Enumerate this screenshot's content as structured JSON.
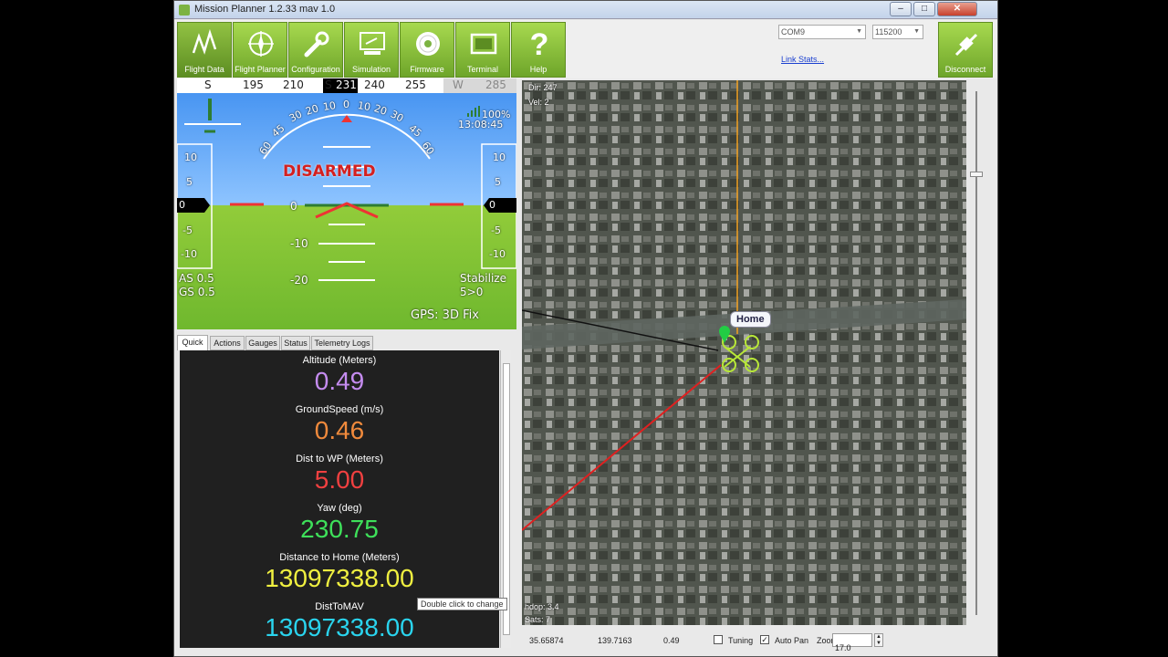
{
  "window": {
    "title": "Mission Planner 1.2.33 mav 1.0",
    "minimize": "–",
    "maximize": "□",
    "close": "✕"
  },
  "toolbar": {
    "buttons": [
      {
        "label": "Flight Data",
        "icon": "flight-data-icon"
      },
      {
        "label": "Flight Planner",
        "icon": "flight-planner-icon"
      },
      {
        "label": "Configuration",
        "icon": "configuration-icon"
      },
      {
        "label": "Simulation",
        "icon": "simulation-icon"
      },
      {
        "label": "Firmware",
        "icon": "firmware-icon"
      },
      {
        "label": "Terminal",
        "icon": "terminal-icon"
      },
      {
        "label": "Help",
        "icon": "help-icon"
      }
    ],
    "com_port": "COM9",
    "baud_rate": "115200",
    "link_stats": "Link Stats...",
    "disconnect": "Disconnect"
  },
  "hud": {
    "heading_ticks": [
      "S",
      "195",
      "210",
      "S",
      "240",
      "255",
      "W",
      "285"
    ],
    "heading_value": "231",
    "battery": "100%",
    "time": "13:08:45",
    "arm_status": "DISARMED",
    "pitch_labels": [
      "0",
      "-10",
      "-20"
    ],
    "roll_scale_left": [
      "60",
      "45",
      "30",
      "20",
      "10"
    ],
    "roll_scale_right": [
      "10",
      "20",
      "30",
      "45",
      "60"
    ],
    "roll_zero": "0",
    "speed_ticks": [
      "10",
      "5",
      "0",
      "-5",
      "-10"
    ],
    "alt_ticks": [
      "10",
      "5",
      "0",
      "-5",
      "-10"
    ],
    "airspeed": "AS 0.5",
    "groundspeed": "GS 0.5",
    "mode": "Stabilize",
    "wp": "5>0",
    "gps": "GPS: 3D Fix"
  },
  "tabs": [
    "Quick",
    "Actions",
    "Gauges",
    "Status",
    "Telemetry Logs"
  ],
  "quick": [
    {
      "label": "Altitude (Meters)",
      "value": "0.49",
      "color": "#c58cf0"
    },
    {
      "label": "GroundSpeed (m/s)",
      "value": "0.46",
      "color": "#f08a3c"
    },
    {
      "label": "Dist to WP (Meters)",
      "value": "5.00",
      "color": "#f04040"
    },
    {
      "label": "Yaw (deg)",
      "value": "230.75",
      "color": "#3ee05a"
    },
    {
      "label": "Distance to Home (Meters)",
      "value": "13097338.00",
      "color": "#f0f040"
    },
    {
      "label": "DistToMAV",
      "value": "13097338.00",
      "color": "#2ad4ee"
    }
  ],
  "tooltip": "Double click to change",
  "map": {
    "dir": "Dir: 247",
    "vel": "Vel: 2",
    "home_label": "Home",
    "hdop": "hdop: 3.4",
    "sats": "Sats: 7"
  },
  "status_bar": {
    "lat": "35.65874",
    "lng": "139.7163",
    "alt": "0.49",
    "tuning_label": "Tuning",
    "tuning_checked": false,
    "autopan_label": "Auto Pan",
    "autopan_checked": true,
    "zoom_label": "Zoom",
    "zoom_value": "17.0"
  }
}
